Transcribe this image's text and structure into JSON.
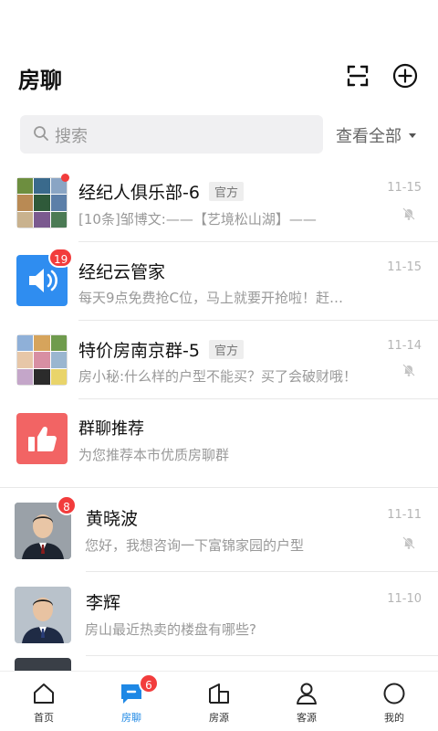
{
  "header": {
    "title": "房聊"
  },
  "search": {
    "placeholder": "搜索",
    "view_all": "查看全部"
  },
  "conversations": [
    {
      "name": "经纪人俱乐部-6",
      "tag": "官方",
      "preview": "[10条]邹博文:——【艺境松山湖】——",
      "time": "11-15",
      "muted": true,
      "unread_dot": true
    },
    {
      "name": "经纪云管家",
      "preview": "每天9点免费抢C位，马上就要开抢啦！赶…",
      "time": "11-15",
      "badge": "19"
    },
    {
      "name": "特价房南京群-5",
      "tag": "官方",
      "preview": "房小秘:什么样的户型不能买？买了会破财哦！",
      "time": "11-14",
      "muted": true
    },
    {
      "name": "群聊推荐",
      "preview": "为您推荐本市优质房聊群"
    },
    {
      "name": "黄晓波",
      "preview": "您好，我想咨询一下富锦家园的户型",
      "time": "11-11",
      "muted": true,
      "badge": "8"
    },
    {
      "name": "李辉",
      "preview": "房山最近热卖的楼盘有哪些?",
      "time": "11-10"
    }
  ],
  "tabs": [
    {
      "label": "首页",
      "icon": "home-icon"
    },
    {
      "label": "房聊",
      "icon": "chat-icon",
      "badge": "6",
      "active": true
    },
    {
      "label": "房源",
      "icon": "building-icon"
    },
    {
      "label": "客源",
      "icon": "person-icon"
    },
    {
      "label": "我的",
      "icon": "profile-icon"
    }
  ],
  "colors": {
    "accent": "#1e88e5",
    "badge": "#f23c3c",
    "promo_red": "#f26464"
  }
}
